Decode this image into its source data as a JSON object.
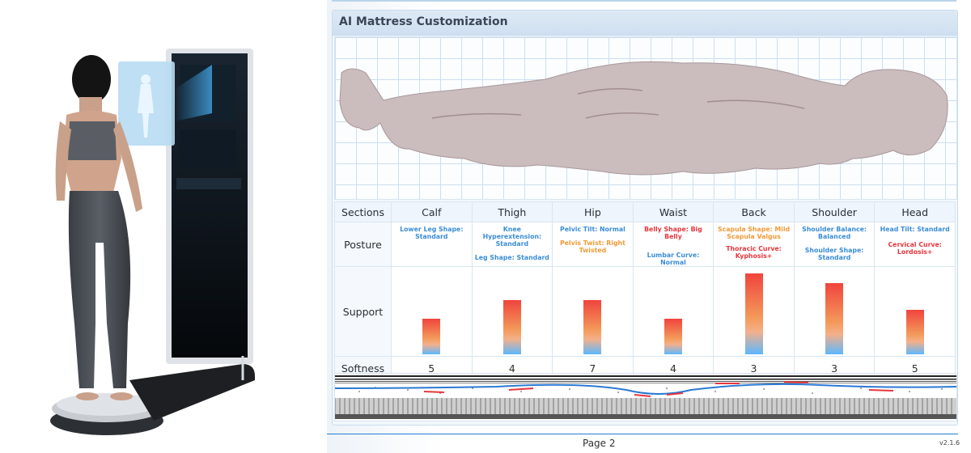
{
  "panel": {
    "title": "AI Mattress Customization"
  },
  "table": {
    "sections_label": "Sections",
    "posture_label": "Posture",
    "support_label": "Support",
    "softness_label": "Softness",
    "columns": [
      {
        "name": "Calf",
        "posture": [
          {
            "text": "Lower Leg Shape: Standard",
            "color": "blue"
          }
        ],
        "support": 0.42,
        "softness": "5"
      },
      {
        "name": "Thigh",
        "posture": [
          {
            "text": "Knee Hyperextension: Standard",
            "color": "blue"
          },
          {
            "text": "Leg Shape: Standard",
            "color": "blue"
          }
        ],
        "support": 0.64,
        "softness": "4"
      },
      {
        "name": "Hip",
        "posture": [
          {
            "text": "Pelvic Tilt: Normal",
            "color": "blue"
          },
          {
            "text": "Pelvis Twist: Right Twisted",
            "color": "orange"
          }
        ],
        "support": 0.64,
        "softness": "7"
      },
      {
        "name": "Waist",
        "posture": [
          {
            "text": "Belly Shape: Big Belly",
            "color": "red"
          },
          {
            "text": "Lumbar Curve: Normal",
            "color": "blue"
          }
        ],
        "support": 0.42,
        "softness": "4"
      },
      {
        "name": "Back",
        "posture": [
          {
            "text": "Scapula Shape: Mild Scapula Valgus",
            "color": "orange"
          },
          {
            "text": "Thoracic Curve: Kyphosis+",
            "color": "red"
          }
        ],
        "support": 0.96,
        "softness": "3"
      },
      {
        "name": "Shoulder",
        "posture": [
          {
            "text": "Shoulder Balance: Balanced",
            "color": "blue"
          },
          {
            "text": "Shoulder Shape: Standard",
            "color": "blue"
          }
        ],
        "support": 0.85,
        "softness": "3"
      },
      {
        "name": "Head",
        "posture": [
          {
            "text": "Head Tilt: Standard",
            "color": "blue"
          },
          {
            "text": "Cervical Curve: Lordosis+",
            "color": "red"
          }
        ],
        "support": 0.53,
        "softness": "5"
      }
    ]
  },
  "footer": {
    "page": "Page 2",
    "version": "v2.1.6"
  },
  "colors": {
    "accent": "#1f7fd4",
    "bar_top": "#f0443d",
    "bar_bottom": "#5cb8ff",
    "mattress_curve": "#2b79d3",
    "mattress_marks": "#e5363d"
  }
}
